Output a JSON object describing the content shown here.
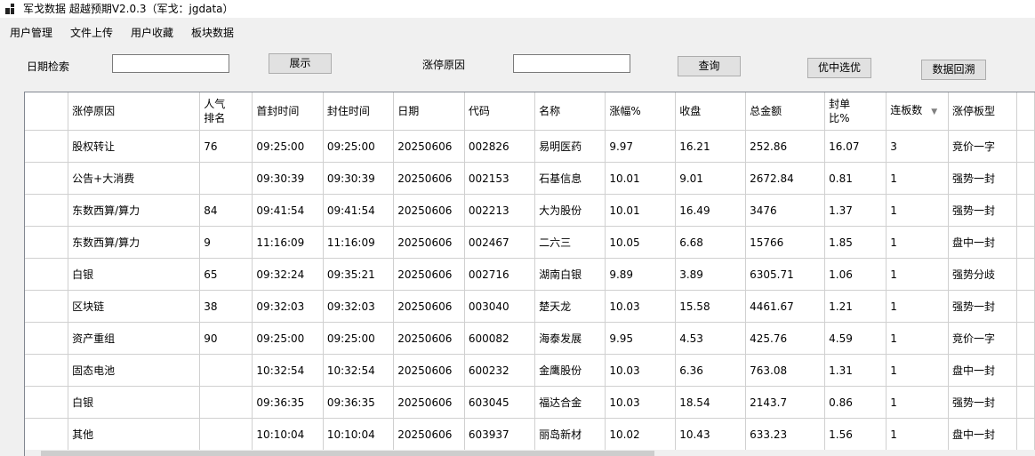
{
  "window": {
    "title": "军戈数据 超越预期V2.0.3（军戈：jgdata）"
  },
  "menu": [
    "用户管理",
    "文件上传",
    "用户收藏",
    "板块数据"
  ],
  "toolbar": {
    "date_label": "日期检索",
    "date_value": "",
    "show_button": "展示",
    "reason_label": "涨停原因",
    "reason_value": "",
    "query_button": "查询",
    "pick_button": "优中选优",
    "backtrack_button": "数据回溯"
  },
  "table": {
    "columns": [
      {
        "key": "reason",
        "label": "涨停原因"
      },
      {
        "key": "pop",
        "label": "人气排名"
      },
      {
        "key": "first_seal",
        "label": "首封时间"
      },
      {
        "key": "seal",
        "label": "封住时间"
      },
      {
        "key": "date",
        "label": "日期"
      },
      {
        "key": "code",
        "label": "代码"
      },
      {
        "key": "name",
        "label": "名称"
      },
      {
        "key": "pct",
        "label": "涨幅%"
      },
      {
        "key": "close",
        "label": "收盘"
      },
      {
        "key": "amount",
        "label": "总金额"
      },
      {
        "key": "ratio",
        "label": "封单比%"
      },
      {
        "key": "streak",
        "label": "连板数"
      },
      {
        "key": "type",
        "label": "涨停板型"
      }
    ],
    "sort_icon": "sort-descending-icon",
    "rows": [
      [
        "股权转让",
        "76",
        "09:25:00",
        "09:25:00",
        "20250606",
        "002826",
        "易明医药",
        "9.97",
        "16.21",
        "252.86",
        "16.07",
        "3",
        "竞价一字"
      ],
      [
        "公告+大消费",
        "",
        "09:30:39",
        "09:30:39",
        "20250606",
        "002153",
        "石基信息",
        "10.01",
        "9.01",
        "2672.84",
        "0.81",
        "1",
        "强势一封"
      ],
      [
        "东数西算/算力",
        "84",
        "09:41:54",
        "09:41:54",
        "20250606",
        "002213",
        "大为股份",
        "10.01",
        "16.49",
        "3476",
        "1.37",
        "1",
        "强势一封"
      ],
      [
        "东数西算/算力",
        "9",
        "11:16:09",
        "11:16:09",
        "20250606",
        "002467",
        "二六三",
        "10.05",
        "6.68",
        "15766",
        "1.85",
        "1",
        "盘中一封"
      ],
      [
        "白银",
        "65",
        "09:32:24",
        "09:35:21",
        "20250606",
        "002716",
        "湖南白银",
        "9.89",
        "3.89",
        "6305.71",
        "1.06",
        "1",
        "强势分歧"
      ],
      [
        "区块链",
        "38",
        "09:32:03",
        "09:32:03",
        "20250606",
        "003040",
        "楚天龙",
        "10.03",
        "15.58",
        "4461.67",
        "1.21",
        "1",
        "强势一封"
      ],
      [
        "资产重组",
        "90",
        "09:25:00",
        "09:25:00",
        "20250606",
        "600082",
        "海泰发展",
        "9.95",
        "4.53",
        "425.76",
        "4.59",
        "1",
        "竞价一字"
      ],
      [
        "固态电池",
        "",
        "10:32:54",
        "10:32:54",
        "20250606",
        "600232",
        "金鹰股份",
        "10.03",
        "6.36",
        "763.08",
        "1.31",
        "1",
        "盘中一封"
      ],
      [
        "白银",
        "",
        "09:36:35",
        "09:36:35",
        "20250606",
        "603045",
        "福达合金",
        "10.03",
        "18.54",
        "2143.7",
        "0.86",
        "1",
        "强势一封"
      ],
      [
        "其他",
        "",
        "10:10:04",
        "10:10:04",
        "20250606",
        "603937",
        "丽岛新材",
        "10.02",
        "10.43",
        "633.23",
        "1.56",
        "1",
        "盘中一封"
      ]
    ]
  }
}
